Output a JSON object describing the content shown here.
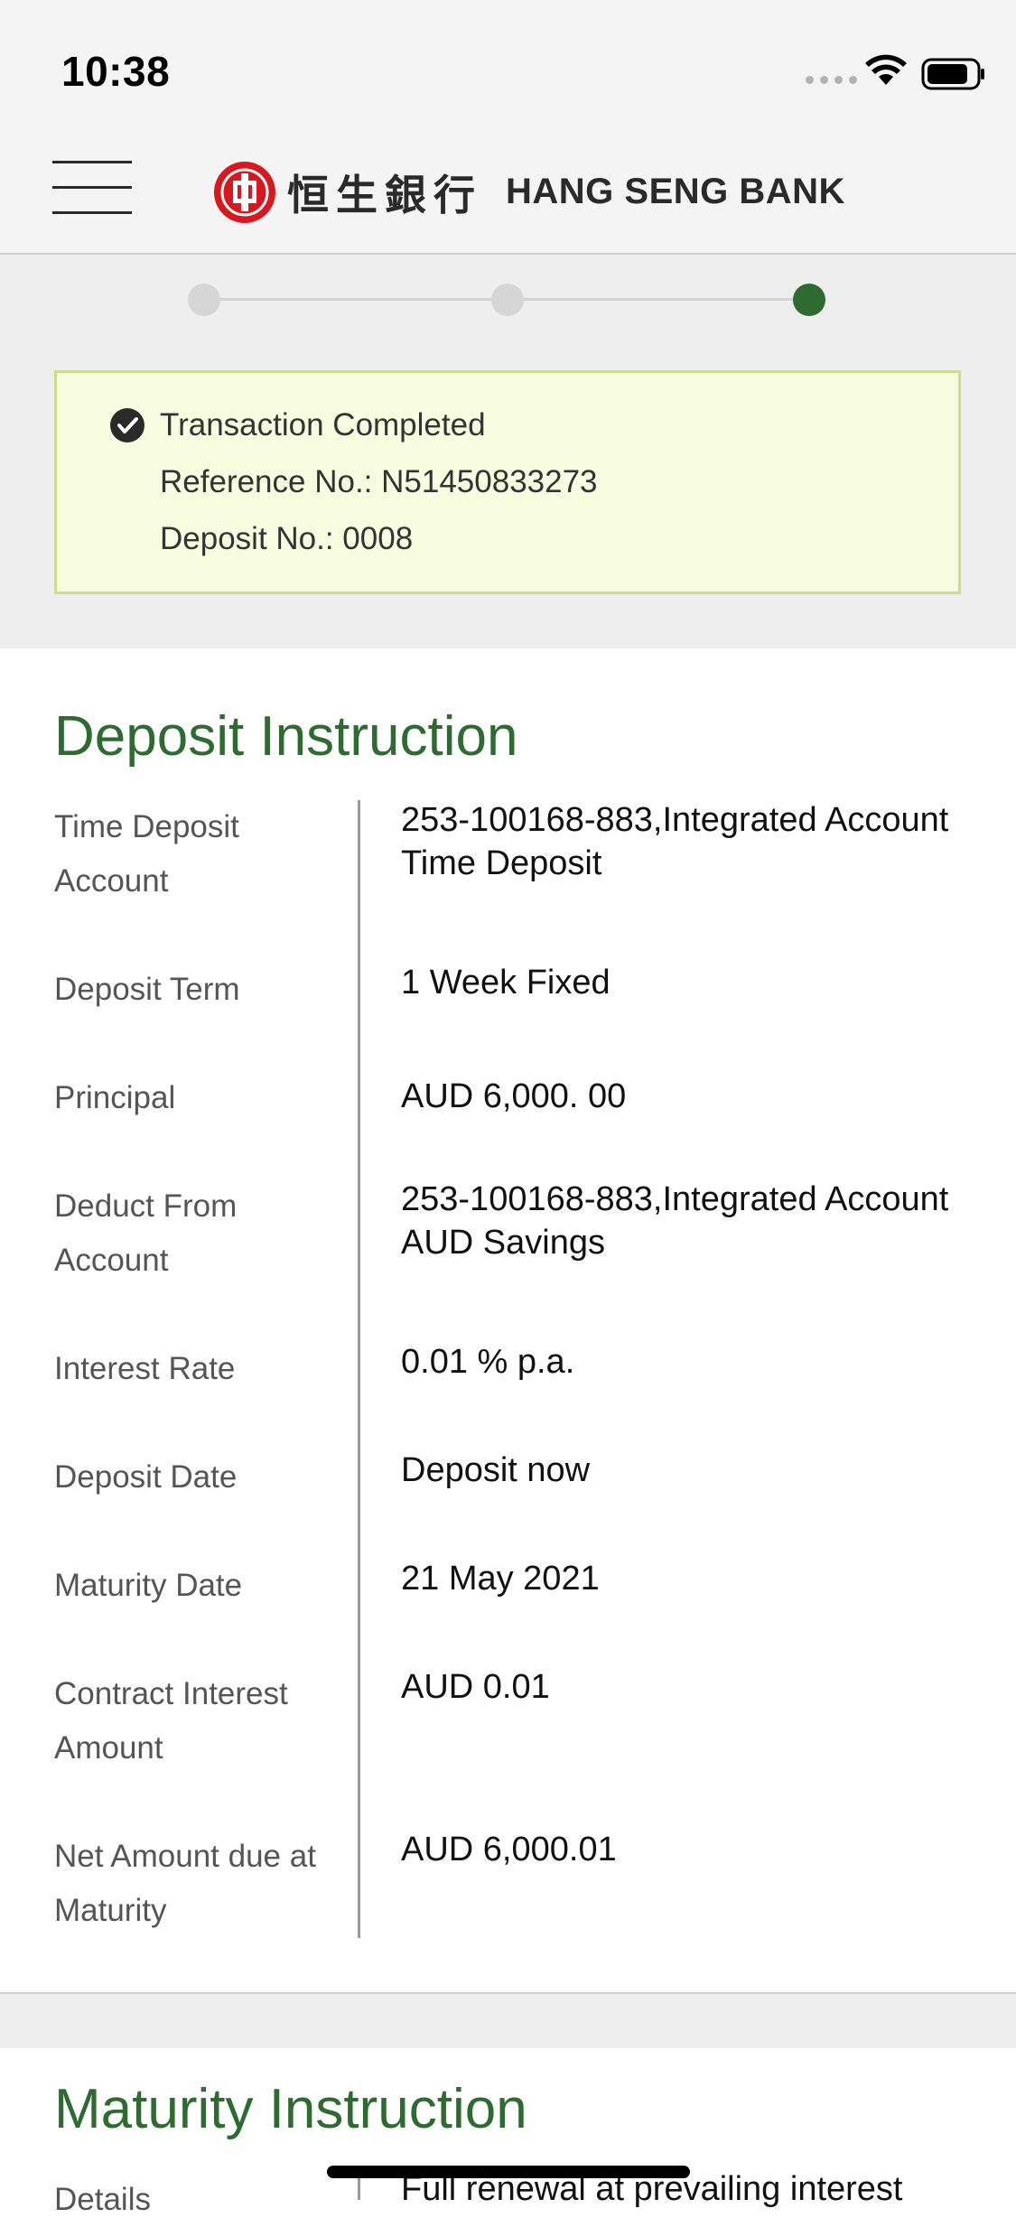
{
  "status_bar": {
    "time": "10:38"
  },
  "header": {
    "bank_name_chinese": "恒生銀行",
    "bank_name_english": "HANG SENG BANK",
    "brand_color": "#d7191f"
  },
  "progress": {
    "total_steps": 3,
    "current_step": 3,
    "active_color": "#2e6b31"
  },
  "confirmation": {
    "status": "Transaction Completed",
    "reference": "Reference No.: N51450833273",
    "deposit_no": "Deposit No.: 0008"
  },
  "deposit_instruction": {
    "title": "Deposit Instruction",
    "rows": [
      {
        "label": "Time Deposit Account",
        "value": "253-100168-883,Integrated Account Time Deposit"
      },
      {
        "label": "Deposit Term",
        "value": "1 Week Fixed"
      },
      {
        "label": "Principal",
        "value": "AUD 6,000. 00"
      },
      {
        "label": "Deduct From Account",
        "value": "253-100168-883,Integrated Account AUD Savings"
      },
      {
        "label": "Interest Rate",
        "value": "0.01 % p.a."
      },
      {
        "label": "Deposit Date",
        "value": "Deposit now"
      },
      {
        "label": "Maturity Date",
        "value": "21 May 2021"
      },
      {
        "label": "Contract Interest Amount",
        "value": "AUD 0.01"
      },
      {
        "label": "Net Amount due at Maturity",
        "value": "AUD 6,000.01"
      }
    ]
  },
  "maturity_instruction": {
    "title": "Maturity Instruction",
    "rows": [
      {
        "label": "Details",
        "value": "Full renewal at prevailing interest"
      }
    ]
  },
  "colors": {
    "accent_green": "#2e6b31",
    "success_bg": "#f8fde0",
    "success_border": "#cbdd8c"
  }
}
